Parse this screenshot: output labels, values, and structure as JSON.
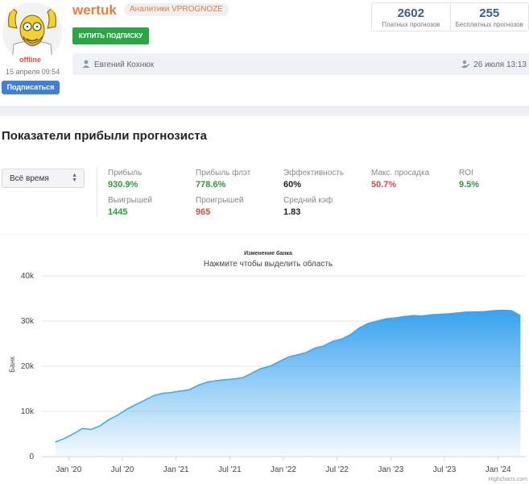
{
  "profile": {
    "username": "wertuk",
    "badge": "Аналитики VPROGNOZE",
    "status": "offline",
    "status_date": "15 апреля 09:54",
    "subscribe_label": "Подписаться",
    "buy_label": "КУПИТЬ ПОДПИСКУ",
    "author": "Евгений Кохнюк",
    "author_date": "26 июля 13:13"
  },
  "stats": {
    "paid_count": "2602",
    "paid_label": "Платных прогнозов",
    "free_count": "255",
    "free_label": "Бесплатных прогнозов"
  },
  "section": {
    "title": "Показатели прибыли прогнозиста",
    "period": "Всё время"
  },
  "metrics": {
    "profit_label": "Прибыль",
    "profit": "930.9%",
    "flat_label": "Прибыль флэт",
    "flat": "778.6%",
    "eff_label": "Эффективность",
    "eff": "60%",
    "dd_label": "Макс. просадка",
    "dd": "50.7%",
    "roi_label": "ROI",
    "roi": "9.5%",
    "wins_label": "Выигрышей",
    "wins": "1445",
    "losses_label": "Проигрышей",
    "losses": "965",
    "coef_label": "Средний кэф",
    "coef": "1.83"
  },
  "colors": {
    "accent_orange": "#e87e3a",
    "green": "#2e9a3e",
    "red": "#e04848",
    "blue": "#3f7fd6",
    "chart_fill": "#3aa6f2"
  },
  "chart_data": {
    "type": "area",
    "title": "Изменение банка",
    "subtitle": "Нажмите чтобы выделить область",
    "ylabel": "Банк",
    "ylim": [
      0,
      40000
    ],
    "yticks": [
      "0",
      "10k",
      "20k",
      "30k",
      "40k"
    ],
    "xticks": [
      "Jan '20",
      "Jul '20",
      "Jan '21",
      "Jul '21",
      "Jan '22",
      "Jul '22",
      "Jan '23",
      "Jul '23",
      "Jan '24"
    ],
    "credit": "Highcharts.com",
    "series": [
      {
        "x": [
          "2019-11",
          "2019-12",
          "2020-01",
          "2020-02",
          "2020-03",
          "2020-04",
          "2020-05",
          "2020-06",
          "2020-07",
          "2020-08",
          "2020-09",
          "2020-10",
          "2020-11",
          "2020-12",
          "2021-01",
          "2021-02",
          "2021-03",
          "2021-04",
          "2021-05",
          "2021-06",
          "2021-07",
          "2021-08",
          "2021-09",
          "2021-10",
          "2021-11",
          "2021-12",
          "2022-01",
          "2022-02",
          "2022-03",
          "2022-04",
          "2022-05",
          "2022-06",
          "2022-07",
          "2022-08",
          "2022-09",
          "2022-10",
          "2022-11",
          "2022-12",
          "2023-01",
          "2023-02",
          "2023-03",
          "2023-04",
          "2023-05",
          "2023-06",
          "2023-07",
          "2023-08",
          "2023-09",
          "2023-10",
          "2023-11",
          "2023-12",
          "2024-01",
          "2024-02",
          "2024-03"
        ],
        "y": [
          3200,
          4000,
          5000,
          6200,
          6000,
          6800,
          8200,
          9200,
          10500,
          11500,
          12500,
          13500,
          14000,
          14200,
          14500,
          14800,
          15800,
          16500,
          16800,
          17000,
          17200,
          17500,
          18500,
          19500,
          20000,
          21000,
          22000,
          22500,
          23000,
          24000,
          24500,
          25500,
          26000,
          27000,
          28500,
          29500,
          30000,
          30500,
          30700,
          31000,
          31200,
          31100,
          31400,
          31500,
          31600,
          31800,
          32000,
          32000,
          32100,
          32300,
          32400,
          32300,
          31200
        ]
      }
    ]
  }
}
